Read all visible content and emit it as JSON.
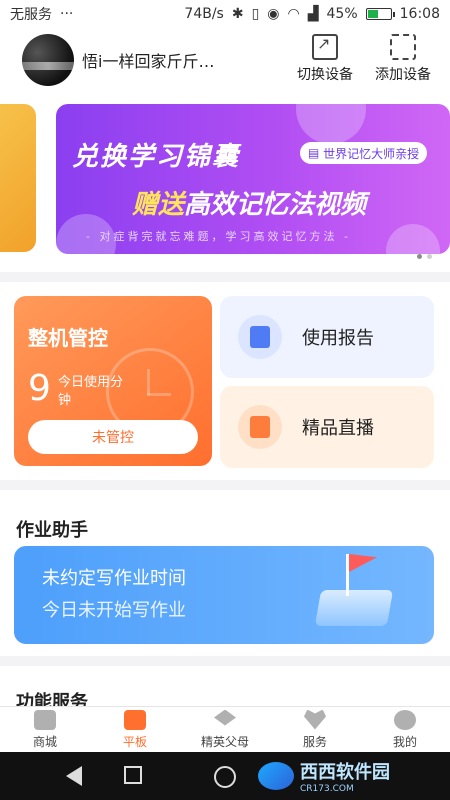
{
  "status": {
    "carrier": "无服务",
    "menu": "···",
    "net_speed": "74B/s",
    "battery_pct": "45%",
    "time": "16:08"
  },
  "header": {
    "username": "悟i一样回家斤斤计...",
    "switch_device": "切换设备",
    "add_device": "添加设备"
  },
  "banner": {
    "line1": "兑换学习锦囊",
    "tag": "世界记忆大师亲授",
    "line2_highlight": "赠送",
    "line2_rest": "高效记忆法视频",
    "line3": "- 对症背完就忘难题，学习高效记忆方法 -",
    "current_page": 1,
    "total_pages": 2
  },
  "control": {
    "title": "整机管控",
    "minutes": "9",
    "subtitle": "今日使用分钟",
    "button": "未管控"
  },
  "tiles": {
    "report": "使用报告",
    "live": "精品直播"
  },
  "homework": {
    "title": "作业助手",
    "line1": "未约定写作业时间",
    "line2": "今日未开始写作业"
  },
  "partial": {
    "title": "功能服务"
  },
  "tabs": [
    {
      "label": "商城",
      "icon": "mall-icon"
    },
    {
      "label": "平板",
      "icon": "tablet-play-icon"
    },
    {
      "label": "精英父母",
      "icon": "graduation-cap-icon"
    },
    {
      "label": "服务",
      "icon": "service-heart-icon"
    },
    {
      "label": "我的",
      "icon": "profile-icon"
    }
  ],
  "watermark": {
    "text": "西西软件园",
    "sub": "CR173.COM"
  },
  "colors": {
    "accent_orange": "#ff6f2e",
    "banner_purple": "#8b3ff0",
    "homework_blue": "#4d9ffb"
  }
}
